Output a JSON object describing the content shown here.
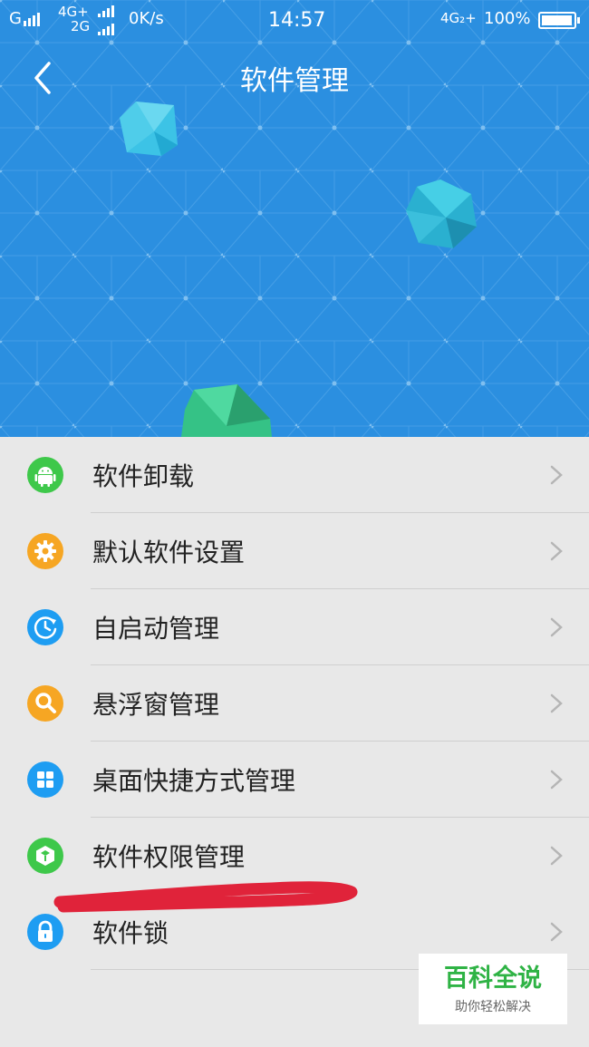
{
  "status_bar": {
    "left_net_1": "G",
    "left_net_2_top": "4G+",
    "left_net_2_bottom": "2G",
    "speed": "0K/s",
    "time": "14:57",
    "right_net": "4G₂+",
    "battery": "100%"
  },
  "header": {
    "title": "软件管理",
    "back_icon": "chevron-left-icon"
  },
  "menu": {
    "items": [
      {
        "label": "软件卸载",
        "icon": "android-icon",
        "color": "#3ec84a"
      },
      {
        "label": "默认软件设置",
        "icon": "gear-icon",
        "color": "#f6a623"
      },
      {
        "label": "自启动管理",
        "icon": "auto-start-icon",
        "color": "#1e9df2"
      },
      {
        "label": "悬浮窗管理",
        "icon": "wrench-icon",
        "color": "#f6a623"
      },
      {
        "label": "桌面快捷方式管理",
        "icon": "grid-icon",
        "color": "#1e9df2"
      },
      {
        "label": "软件权限管理",
        "icon": "cube-icon",
        "color": "#3ec84a"
      },
      {
        "label": "软件锁",
        "icon": "lock-icon",
        "color": "#1e9df2"
      }
    ]
  },
  "annotation": {
    "color": "#e0233a"
  },
  "watermark": {
    "main": "百科全说",
    "sub": "助你轻松解决"
  },
  "colors": {
    "header_bg": "#2b8fe0",
    "list_bg": "#e8e8e8"
  }
}
